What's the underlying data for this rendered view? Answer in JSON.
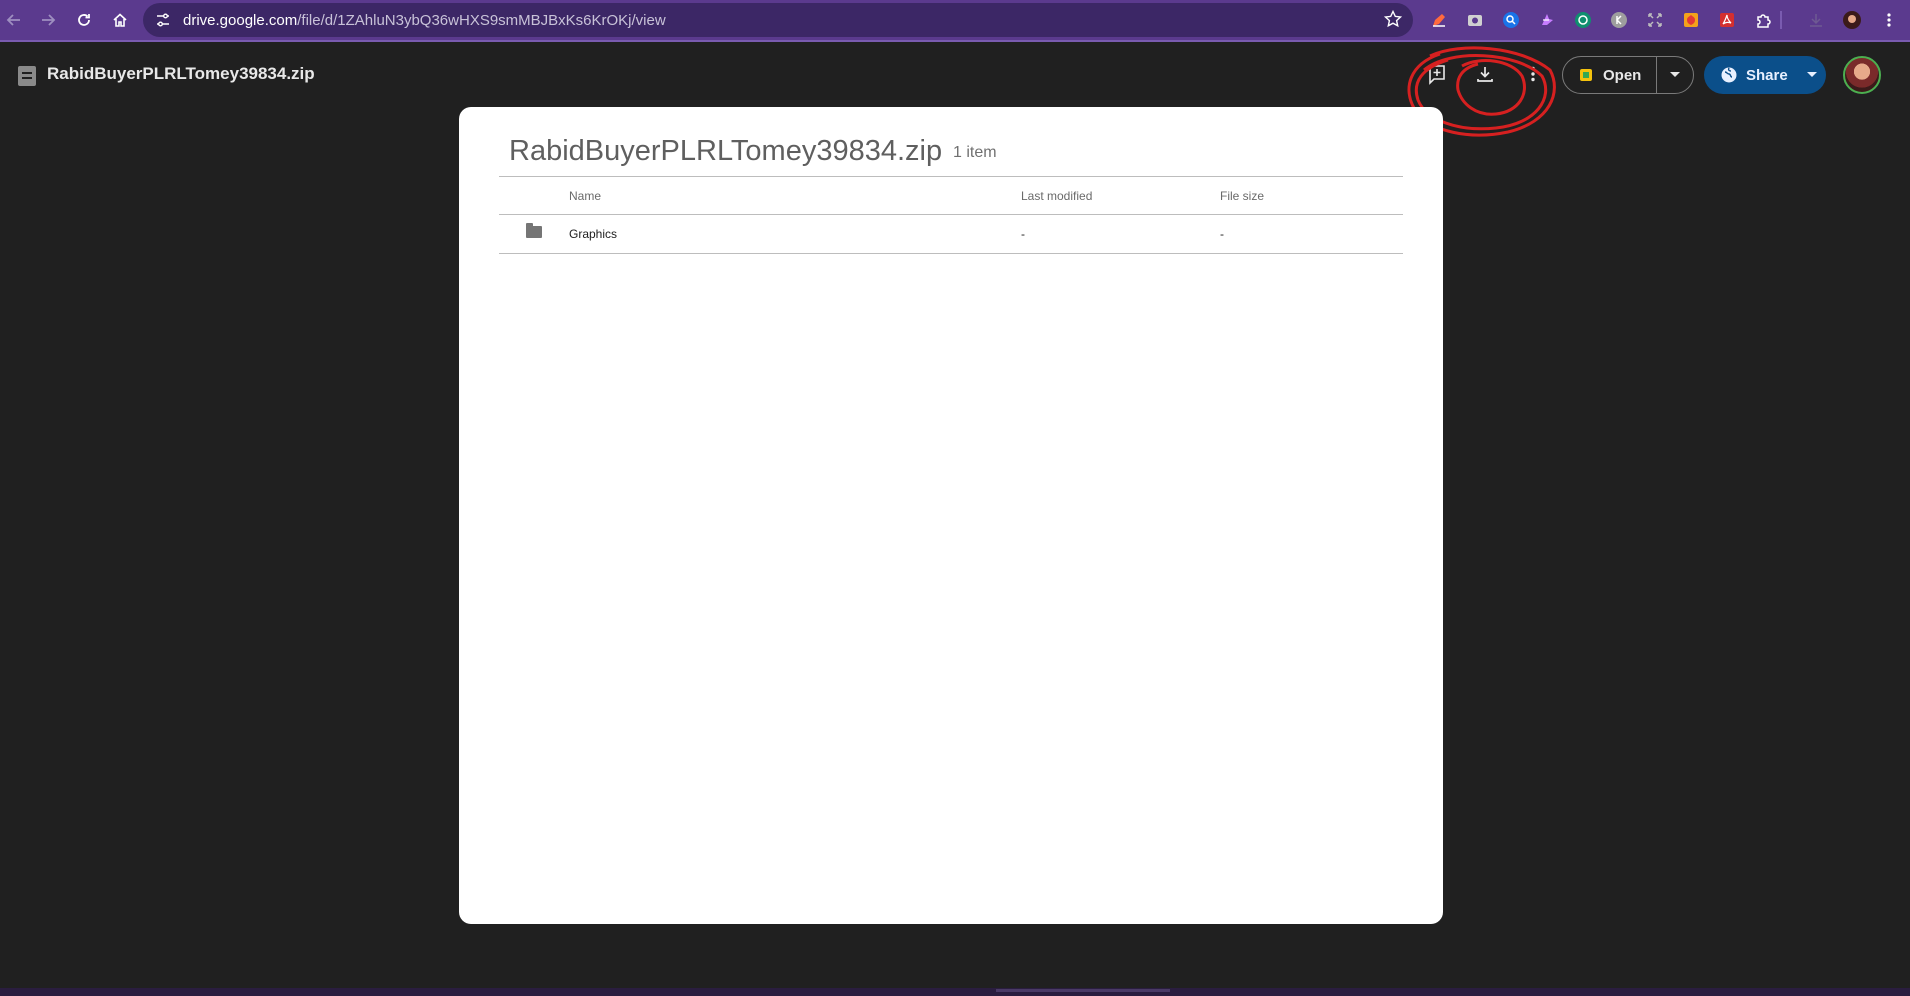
{
  "browser": {
    "url_host": "drive.google.com",
    "url_path": "/file/d/1ZAhluN3ybQ36wHXS9smMBJBxKs6KrOKj/view",
    "icons": {
      "back": "arrow-left-icon",
      "forward": "arrow-right-icon",
      "reload": "reload-icon",
      "home": "home-icon",
      "site_info": "tune-icon",
      "bookmark": "star-icon"
    },
    "extensions": [
      "pen-icon",
      "camera-icon",
      "search-ext-icon",
      "sparkle-icon",
      "chatgpt-icon",
      "k-icon",
      "expand-icon",
      "shield-icon",
      "pdf-icon",
      "puzzle-icon",
      "download-icon",
      "profile-icon",
      "more-vert-icon"
    ]
  },
  "header": {
    "file_name": "RabidBuyerPLRLTomey39834.zip",
    "actions": {
      "add_to_drive_icon": "add-to-drive-icon",
      "download_icon": "download-icon",
      "more_icon": "more-vert-icon"
    },
    "open_label": "Open",
    "share_label": "Share"
  },
  "card": {
    "title": "RabidBuyerPLRLTomey39834.zip",
    "count": "1 item",
    "columns": [
      "Name",
      "Last modified",
      "File size"
    ],
    "rows": [
      {
        "name": "Graphics",
        "last_modified": "-",
        "file_size": "-"
      }
    ]
  },
  "colors": {
    "chrome_bar": "#5b3a8e",
    "page_bg": "#202020",
    "card_bg": "#ffffff",
    "share_bg": "#0b4f8a",
    "annotation": "#d62020"
  }
}
